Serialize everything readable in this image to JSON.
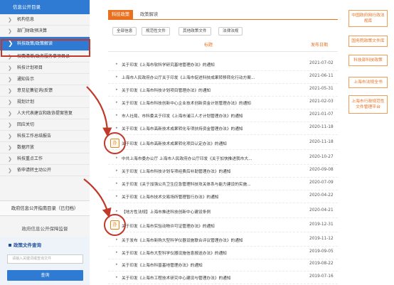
{
  "sidebar": {
    "header": "信息公开目录",
    "items": [
      "机构信息",
      "部门财政预决算",
      "科技政策/政策解读",
      "权责清单/政务服务事项目录",
      "科技计划项目",
      "通知告示",
      "意见征集征询/反馈",
      "规划计划",
      "人大代表建议和政协提案答复",
      "回应关切",
      "科技工作总结报告",
      "数据开放",
      "科技重点工作",
      "依申请转主动公开"
    ],
    "guide": "政府信息公开指南目录（已归档）",
    "supervise": "政府信息公开保障监督",
    "query_title": "政策文件查询",
    "query_placeholder": "请输入关键词或查询文件",
    "query_button": "查询"
  },
  "tabs": [
    "科技政策",
    "政策解读"
  ],
  "filters": [
    "全部信息",
    "规范性文件",
    "其他政策文件",
    "法律法规"
  ],
  "columns": {
    "title": "标题",
    "date": "发布日期"
  },
  "rows": [
    {
      "title": "关于印发《上海市软科学研究基地管理办法》的通知",
      "date": "2021-07-02"
    },
    {
      "title": "上海市人民政府办公厅关于印发《上海市促进科技成果转移转化行动方案...",
      "date": "2021-06-11"
    },
    {
      "title": "关于印发《上海市科技计划项目管理办法》的通知",
      "date": "2021-05-31"
    },
    {
      "title": "关于印发《上海市科技创新中心企业技术创新资金计划管理办法》的通知",
      "date": "2021-02-03"
    },
    {
      "title": "市人社局、市科委关于印发《上海市浦江人才计划管理办法》的通知",
      "date": "2021-01-07"
    },
    {
      "title": "关于印发《上海市高新技术成果转化专项扶持资金管理办法》的通知",
      "date": "2020-11-18"
    },
    {
      "title": "关于印发《上海市高新技术成果转化项目认定办法》的通知",
      "date": "2020-11-18"
    },
    {
      "title": "中共上海市委办公厅 上海市人民政府办公厅印发《关于加快推进我市大...",
      "date": "2020-10-27"
    },
    {
      "title": "关于印发《上海市科技计划专项经费后补助管理办法》的通知",
      "date": "2020-09-08"
    },
    {
      "title": "关于印发《关于加强公共卫生应急管理科技攻关体系与能力建设的实施...",
      "date": "2020-07-09"
    },
    {
      "title": "关于印发《上海市技术交易场所管理暂行办法》的通知",
      "date": "2020-04-22"
    },
    {
      "title": "【地方性法规】上海市推进科技创新中心建设条例",
      "date": "2020-04-21"
    },
    {
      "title": "关于印发《上海市实验动物许可证管理办法》的通知",
      "date": "2019-12-31"
    },
    {
      "title": "关于发布《上海市新购大型科学仪器设施联合评议管理办法》的通知",
      "date": "2019-11-12"
    },
    {
      "title": "关于印发《上海市大型科学仪器设施信息报送办法》的通知",
      "date": "2019-09-05"
    },
    {
      "title": "关于印发《上海市科普基地管理办法》的通知",
      "date": "2019-08-22"
    },
    {
      "title": "关于印发《上海市工程技术研究中心建设与管理办法》的通知",
      "date": "2019-07-16"
    }
  ],
  "badge_label": "办",
  "right_links": [
    "中国政府网行政法规库",
    "国务院政策文件库",
    "科技部科技政策",
    "上海市法规全书",
    "上海市行政规范性文件管理平台"
  ],
  "colors": {
    "accent": "#e8701f",
    "primary": "#2f7ad3",
    "highlight": "#c0392b"
  }
}
